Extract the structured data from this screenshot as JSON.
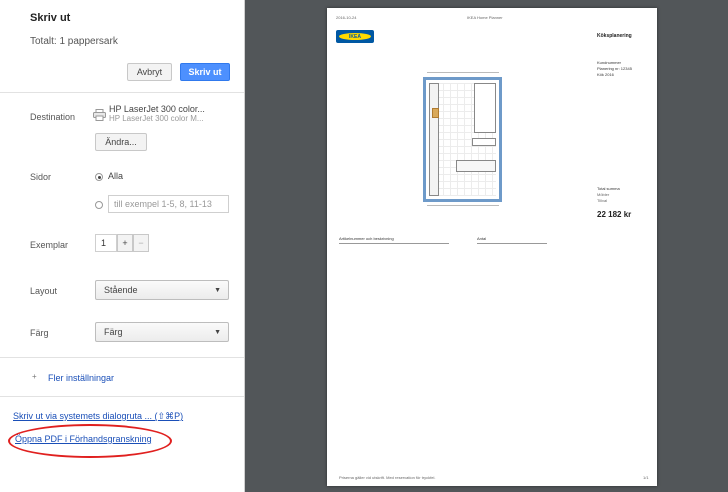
{
  "sidebar": {
    "title": "Skriv ut",
    "subtitle": "Totalt: 1 pappersark",
    "buttons": {
      "cancel": "Avbryt",
      "print": "Skriv ut"
    },
    "destination": {
      "label": "Destination",
      "printer_name": "HP LaserJet 300 color...",
      "printer_sub": "HP LaserJet 300 color M...",
      "change_button": "Ändra..."
    },
    "pages": {
      "label": "Sidor",
      "all_option": "Alla",
      "range_placeholder": "till exempel 1-5, 8, 11-13"
    },
    "copies": {
      "label": "Exemplar",
      "value": "1",
      "plus": "+",
      "minus": "−"
    },
    "layout": {
      "label": "Layout",
      "value": "Stående"
    },
    "color": {
      "label": "Färg",
      "value": "Färg"
    },
    "more_settings": "Fler inställningar",
    "system_dialog_link": "Skriv ut via systemets dialogruta ... (⇧⌘P)",
    "open_pdf_link": "Öppna PDF i Förhandsgranskning"
  },
  "preview": {
    "page_header_left": "2016-10-24",
    "page_header_center": "IKEA Home Planner",
    "logo_text": "IKEA",
    "project_name": "Köksplanering",
    "product_info": [
      "Kundnummer",
      "Planering nr: 12345",
      "Kök 2016"
    ],
    "summary_label": "Total summa",
    "summary_rows": [
      "Möbler",
      "Tillval"
    ],
    "total_price": "22 182 kr",
    "footer_left": "Priserna gäller vid utskrift. Med reservation för tryckfel.",
    "footer_right": "1/1",
    "table_headers": [
      "Artikelnummer och beskrivning",
      "Antal"
    ]
  },
  "colors": {
    "accent": "#4d90fe",
    "annotation": "#e0201f",
    "preview_bg": "#525659",
    "plan_border": "#6e9ac9",
    "logo_blue": "#0058a3",
    "logo_yellow": "#ffdb00"
  },
  "icons": {
    "printer": "printer-icon",
    "expand": "chevron-right-icon"
  }
}
